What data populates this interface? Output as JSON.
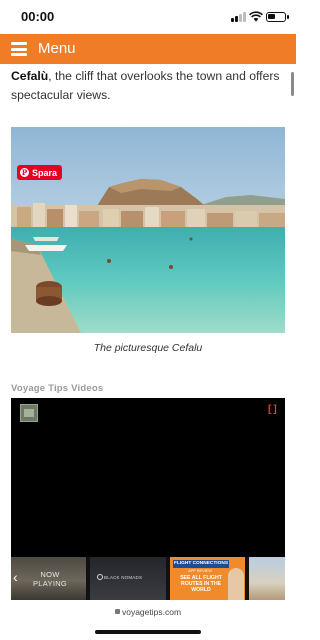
{
  "status_bar": {
    "time": "00:00",
    "battery_level": 0.45
  },
  "menu": {
    "label": "Menu",
    "background_color": "#f07c28"
  },
  "article": {
    "intro_bold": "Cefalù",
    "intro_rest": ", the cliff that overlooks the town and offers spectacular views.",
    "photo": {
      "pin_button_label": "Spara",
      "caption": "The picturesque Cefalu"
    }
  },
  "videos": {
    "heading": "Voyage Tips Videos",
    "playlist": {
      "now_playing_label": "NOW\nPLAYING",
      "item2_text": "BLACK NOMADS",
      "item3_title": "FLIGHT CONNECTIONS",
      "item3_sub": "APP REVIEW",
      "item3_main": "SEE ALL FLIGHT ROUTES IN THE WORLD"
    }
  },
  "browser": {
    "url": "voyagetips.com"
  }
}
